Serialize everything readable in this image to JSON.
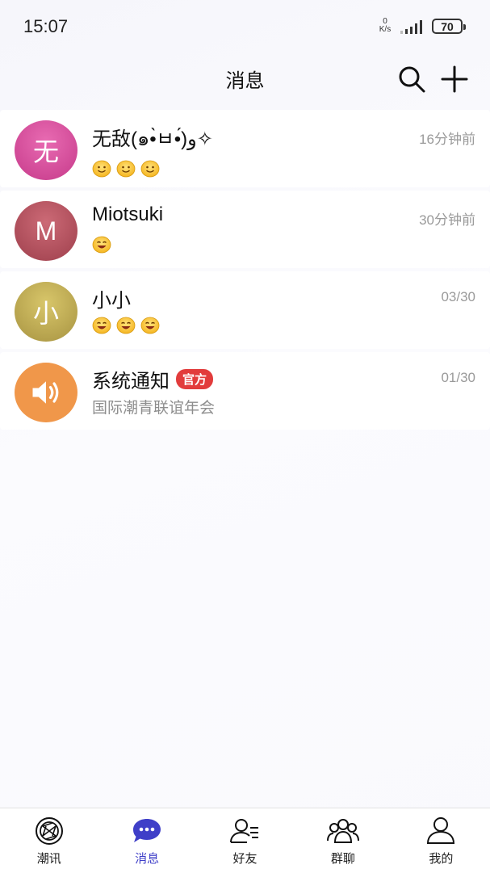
{
  "status_bar": {
    "time": "15:07",
    "net_speed_value": "0",
    "net_speed_unit": "K/s",
    "battery": "70"
  },
  "header": {
    "title": "消息"
  },
  "conversations": [
    {
      "name": "无敌(๑•̀ㅂ•́)و✧",
      "time": "16分钟前",
      "avatar_text": "无",
      "avatar_color": "#d9439a",
      "preview_emoji": [
        "smile",
        "smile",
        "smile"
      ]
    },
    {
      "name": "Miotsuki",
      "time": "30分钟前",
      "avatar_text": "M",
      "avatar_color": "#b24b58",
      "preview_emoji": [
        "grin"
      ]
    },
    {
      "name": "小小",
      "time": "03/30",
      "avatar_text": "小",
      "avatar_color": "#c0ab4f",
      "preview_emoji": [
        "grin",
        "grin",
        "grin"
      ]
    },
    {
      "name": "系统通知",
      "badge": "官方",
      "time": "01/30",
      "avatar_icon": "speaker-icon",
      "avatar_color": "#f0974a",
      "preview_text": "国际潮青联谊年会"
    }
  ],
  "bottom_nav": {
    "items": [
      {
        "label": "潮讯",
        "icon": "aperture-icon"
      },
      {
        "label": "消息",
        "icon": "chat-bubble-icon",
        "active": true
      },
      {
        "label": "好友",
        "icon": "friend-list-icon"
      },
      {
        "label": "群聊",
        "icon": "group-icon"
      },
      {
        "label": "我的",
        "icon": "person-icon"
      }
    ],
    "active_color": "#3f3fc8"
  }
}
